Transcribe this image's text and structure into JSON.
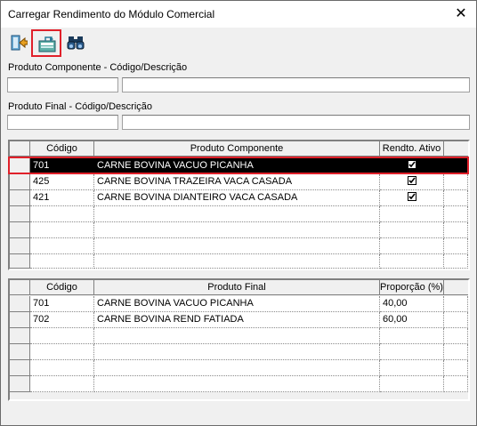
{
  "window": {
    "title": "Carregar Rendimento do Módulo Comercial",
    "close_label": "✕"
  },
  "toolbar": {
    "buttons": [
      {
        "name": "exit-icon"
      },
      {
        "name": "load-icon"
      },
      {
        "name": "binoculars-icon"
      }
    ]
  },
  "filters": {
    "componente_label": "Produto Componente - Código/Descrição",
    "componente_codigo": "",
    "componente_descricao": "",
    "final_label": "Produto Final - Código/Descrição",
    "final_codigo": "",
    "final_descricao": ""
  },
  "grid_componente": {
    "headers": [
      "Código",
      "Produto Componente",
      "Rendto. Ativo"
    ],
    "rows": [
      {
        "codigo": "701",
        "produto": "CARNE BOVINA VACUO PICANHA",
        "ativo": true,
        "selected": true
      },
      {
        "codigo": "425",
        "produto": "CARNE BOVINA TRAZEIRA VACA CASADA",
        "ativo": true,
        "selected": false
      },
      {
        "codigo": "421",
        "produto": "CARNE BOVINA DIANTEIRO VACA CASADA",
        "ativo": true,
        "selected": false
      }
    ]
  },
  "grid_final": {
    "headers": [
      "Código",
      "Produto Final",
      "Proporção (%)"
    ],
    "rows": [
      {
        "codigo": "701",
        "produto": "CARNE BOVINA VACUO PICANHA",
        "proporcao": "40,00"
      },
      {
        "codigo": "702",
        "produto": "CARNE BOVINA REND FATIADA",
        "proporcao": "60,00"
      }
    ]
  },
  "colors": {
    "selection": "#000000",
    "highlight": "#e0202a"
  }
}
